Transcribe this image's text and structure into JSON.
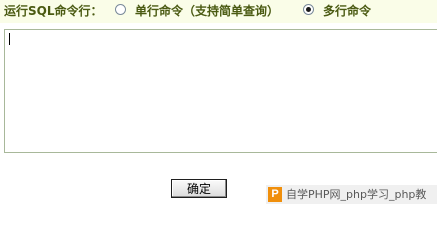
{
  "header": {
    "run_label": "运行SQL命令行：",
    "option_single_label": "单行命令（支持简单查询）",
    "option_multi_label": "多行命令",
    "selected_option": "多行命令"
  },
  "editor": {
    "value": ""
  },
  "actions": {
    "confirm_label": "确定"
  },
  "watermark": {
    "logo_glyph": "P",
    "text": "自学PHP网_php学习_php教"
  },
  "colors": {
    "label_text": "#4a5a12",
    "header_bg": "#fafde8",
    "editor_border": "#a8b89a",
    "watermark_logo": "#f08a00"
  }
}
